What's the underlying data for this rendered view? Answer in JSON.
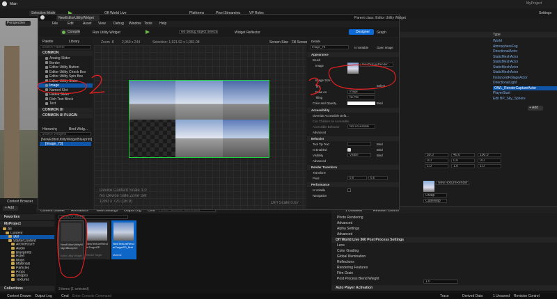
{
  "main": {
    "title": "Main",
    "project_name": "MyProject",
    "mode": "Selection Mode",
    "world": "Off World Live",
    "platforms": "Platforms",
    "pixel_streaming": "Pixel Streaming",
    "vp_roles": "VP Roles",
    "settings": "Settings",
    "perspective": "Perspective",
    "outliner_col_type": "Type",
    "add": "+ Add",
    "outliner_types": [
      "World",
      "AtmosphereFog",
      "DirectionalActor",
      "StaticMeshActor",
      "StaticMeshActor",
      "StaticMeshActor",
      "StaticMeshActor",
      "InstancedFoliageActor",
      "DirectionalLight",
      "OWL_RenderCaptureActor",
      "PlayerStart",
      "Edit BP_Sky_Sphere"
    ],
    "detail_values": [
      "50.0",
      "40.0",
      "100.0",
      "0.0",
      "0.0",
      "0.0",
      "1.0",
      "1.0",
      "1.0"
    ],
    "detail_selects": [
      "UMap",
      "CubeMap",
      "1.0",
      "Dreamless 360 Render"
    ],
    "render_target_label": "NewTextureRenderTarget2D",
    "unsaved": "1 Unsaved",
    "revision_control": "Revision Control",
    "post_rows": [
      "Photo Rendering",
      "Advanced",
      "Alpha Settings",
      "Advanced",
      "Off World Live 360 Post Process Settings",
      "Lens",
      "Color Grading",
      "Global Illumination",
      "Reflections",
      "Rendering Features",
      "Film Grain",
      "Post Process Blend Weight"
    ],
    "post_blend_value": "1.0",
    "auto_player": "Auto Player Activation",
    "bottom": {
      "content_drawer": "Content Drawer",
      "output_log": "Output Log",
      "cmd": "Cmd",
      "console_placeholder": "Enter Console Command",
      "trace": "Trace",
      "derived_data": "Derived Data",
      "unsaved": "1 Unsaved",
      "revision_control": "Revision Control"
    }
  },
  "editor": {
    "tab": "NewEditorUtilityWidget",
    "parent_class": "Parent class: Editor Utility Widget",
    "menu": [
      "File",
      "Edit",
      "Asset",
      "View",
      "Debug",
      "Window",
      "Tools",
      "Help"
    ],
    "compile": "Compile",
    "run": "Run Utility Widget",
    "debug": "No debug object selected",
    "reflector": "Widget Reflector",
    "designer": "Designer",
    "graph": "Graph",
    "palette_tab": "Palette",
    "library_tab": "Library",
    "search_palette": "Search Palette",
    "palette_header": "COMMON",
    "palette_items": [
      "Analog Slider",
      "Border",
      "Editor Utility Button",
      "Editor Utility Check Box",
      "Editor Utility Spin Box",
      "Editor Utility Slider",
      "Image",
      "Named Slot",
      "Radial Slider",
      "Rich Text Block",
      "Text"
    ],
    "palette_sections": [
      "COMMON UI",
      "COMMON UI PLUGIN"
    ],
    "hierarchy_tab": "Hierarchy",
    "bind_widgets_tab": "Bind Widg...",
    "search_widgets": "Search Widgets",
    "hier_root": "[NewEditorUtilityWidgetBlueprint]",
    "hier_child": "[Image_73]",
    "zoom": "Zoom -8",
    "size_readout": "2,950 x 244",
    "selection": "Selection: 1,921.92 x 1,081.08",
    "fill_screen": "Fill Screen",
    "screen_size": "Screen Size",
    "device_content_scale": "Device Content Scale 1.0",
    "device_safe_zone": "No Device Safe Zone Set",
    "resolution": "1280 x 720 (16:9)",
    "dpi": "DPI Scale 0.67",
    "details_tab": "Details",
    "widget_name": "Image_73",
    "is_variable": "Is Variable",
    "open_image": "Open Image",
    "sections": [
      "Appearance",
      "Accessibility",
      "Behavior",
      "Render Transform",
      "Performance"
    ],
    "brush_label": "Brush",
    "brush_asset": "NewTextureRender...",
    "image_label": "Image",
    "image_size": "Image Size",
    "tint": "Tint",
    "draw_as": "Draw As",
    "draw_as_value": "Image",
    "tiling": "Tiling",
    "tiling_value": "No Tile",
    "color_opacity": "Color and Opacity",
    "select": "Select",
    "bind": "Bind",
    "override_access": "Override Accessible Defa...",
    "can_children": "Can Children be Accessible",
    "accessible_behavior": "Accessible Behavior",
    "accessible_value": "Not Accessible",
    "advanced": "Advanced",
    "tooltip_text": "Tool Tip Text",
    "is_enabled": "Is Enabled",
    "visibility": "Visibility",
    "visibility_value": "Visible",
    "transform": "Transform",
    "pivot": "Pivot",
    "pivot_x": "0.5",
    "pivot_y": "0.5",
    "is_volatile": "Is Volatile",
    "navigation": "Navigation",
    "zoom_value": "1.8"
  },
  "content_browser": {
    "title": "Content Browser",
    "add": "+ Add",
    "import": "Import",
    "save": "Save All",
    "tabs": [
      "Content Drawer",
      "Animations",
      "View Bindings",
      "Output Log",
      "Cmd"
    ],
    "console_placeholder": "Enter Console Command",
    "favorites": "Favorites",
    "project": "MyProject",
    "tree": [
      "All",
      "Content",
      "360",
      "StarterContent",
      "Architecture",
      "Audio",
      "Blueprints",
      "HDRI",
      "Maps",
      "Materials",
      "Particles",
      "Props",
      "Shapes",
      "Textures"
    ],
    "collections": "Collections",
    "search": "Search Content",
    "assets": [
      {
        "name": "NewEditorUtilityWidgetBlueprint",
        "type": "Editor Utility Widget"
      },
      {
        "name": "NewTextureRenderTarget2D",
        "type": "Render Target"
      },
      {
        "name": "NewTextureRenderTarget2D_Mat",
        "type": "Material"
      }
    ],
    "status": "3 items (1 selected)"
  },
  "annotations": {
    "palette_number": "2",
    "details_number": "3"
  }
}
